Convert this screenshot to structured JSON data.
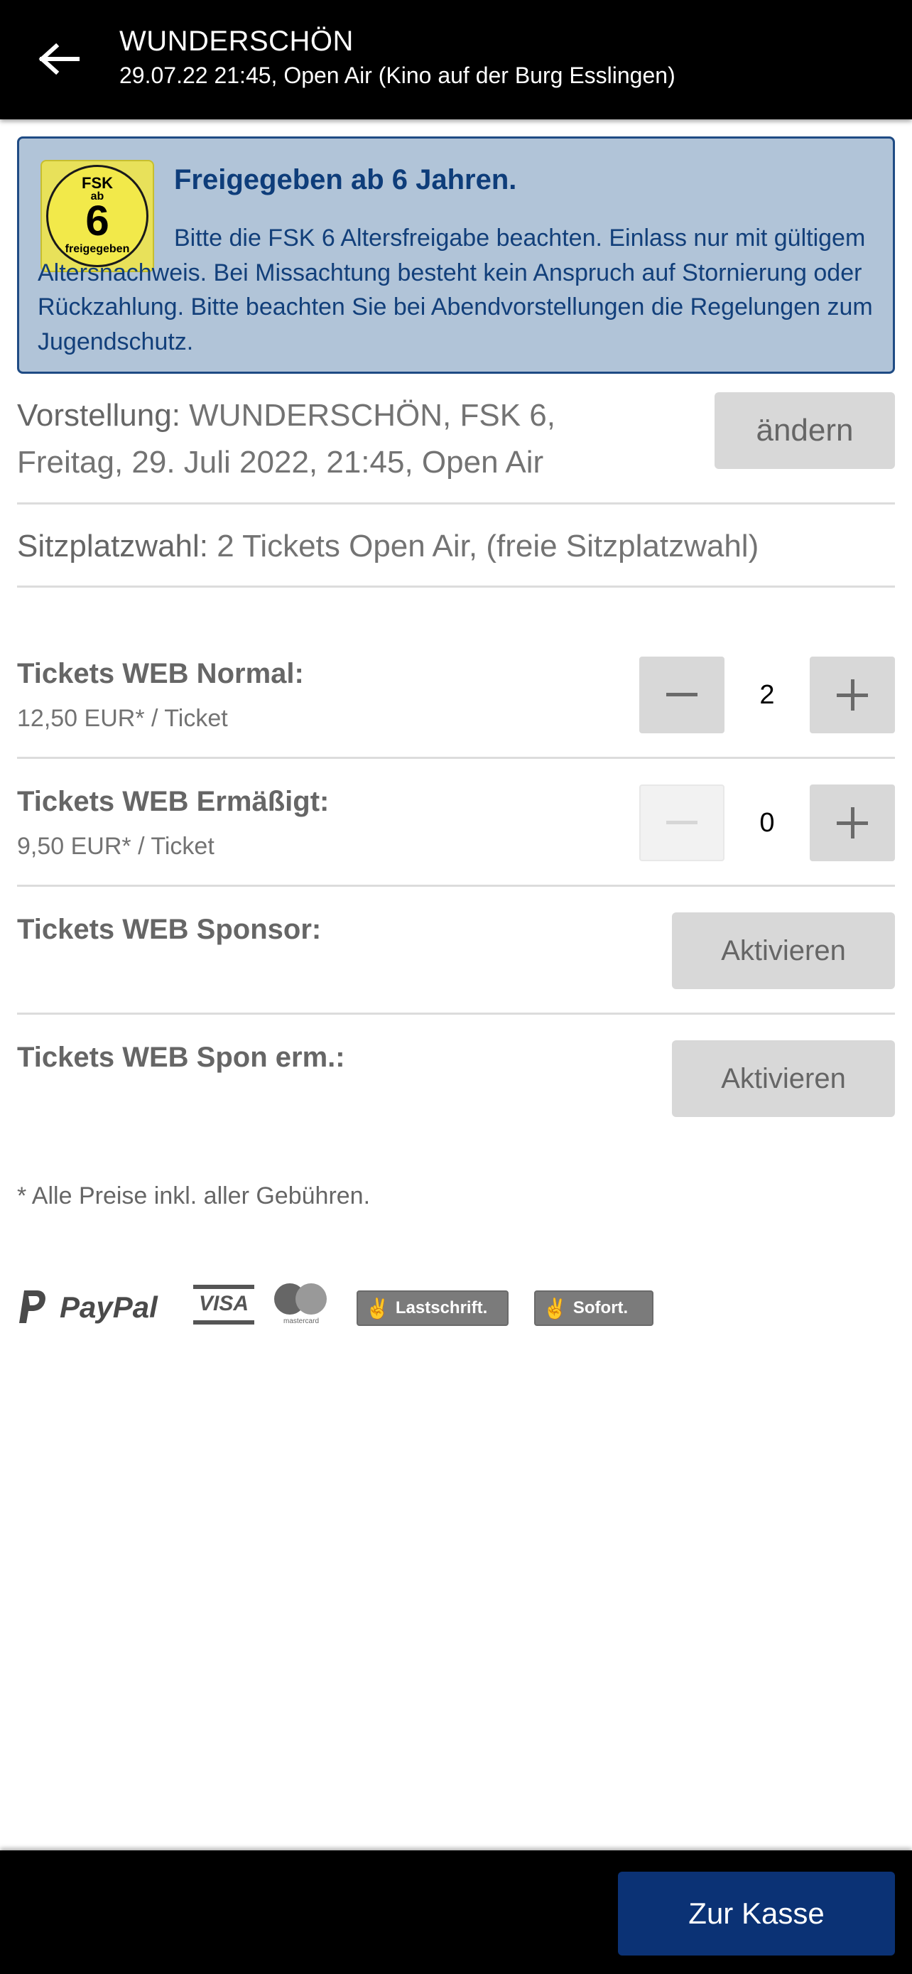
{
  "header": {
    "title": "WUNDERSCHÖN",
    "subtitle": "29.07.22 21:45, Open Air (Kino auf der Burg Esslingen)",
    "back_icon": "arrow-left-icon"
  },
  "fsk_notice": {
    "badge": {
      "top": "FSK",
      "ab": "ab",
      "number": "6",
      "bottom": "freigegeben"
    },
    "heading": "Freigegeben ab 6 Jahren.",
    "text": "Bitte die FSK 6 Altersfreigabe beachten. Einlass nur mit gültigem Altersnachweis. Bei Missachtung besteht kein Anspruch auf Stornierung oder Rückzahlung. Bitte beachten Sie bei Abendvorstellungen die Regelungen zum Jugendschutz.",
    "colors": {
      "background": "#b1c4d8",
      "border": "#1f4b84",
      "text": "#103f7a",
      "badge": "#e8e15a"
    }
  },
  "vorstellung": {
    "label": "Vorstellung:",
    "value": "WUNDERSCHÖN, FSK 6, Freitag, 29. Juli 2022, 21:45, Open Air",
    "change_button": "ändern"
  },
  "sitzplatz": {
    "label": "Sitzplatzwahl:",
    "value": "2 Tickets Open Air, (freie Sitzplatzwahl)"
  },
  "tickets": [
    {
      "label": "Tickets WEB Normal:",
      "price": "12,50 EUR* / Ticket",
      "quantity": "2",
      "control": "stepper",
      "minus_enabled": true
    },
    {
      "label": "Tickets WEB Ermäßigt:",
      "price": "9,50 EUR* / Ticket",
      "quantity": "0",
      "control": "stepper",
      "minus_enabled": false
    },
    {
      "label": "Tickets WEB Sponsor:",
      "control": "activate",
      "button": "Aktivieren"
    },
    {
      "label": "Tickets WEB Spon erm.:",
      "control": "activate",
      "button": "Aktivieren"
    }
  ],
  "footnote": "* Alle Preise inkl. aller Gebühren.",
  "payment_methods": {
    "paypal": "PayPal",
    "visa": "VISA",
    "mastercard": "mastercard",
    "lastschrift": "Lastschrift.",
    "sofort": "Sofort."
  },
  "checkout": {
    "button": "Zur Kasse",
    "color": "#0b3275"
  }
}
